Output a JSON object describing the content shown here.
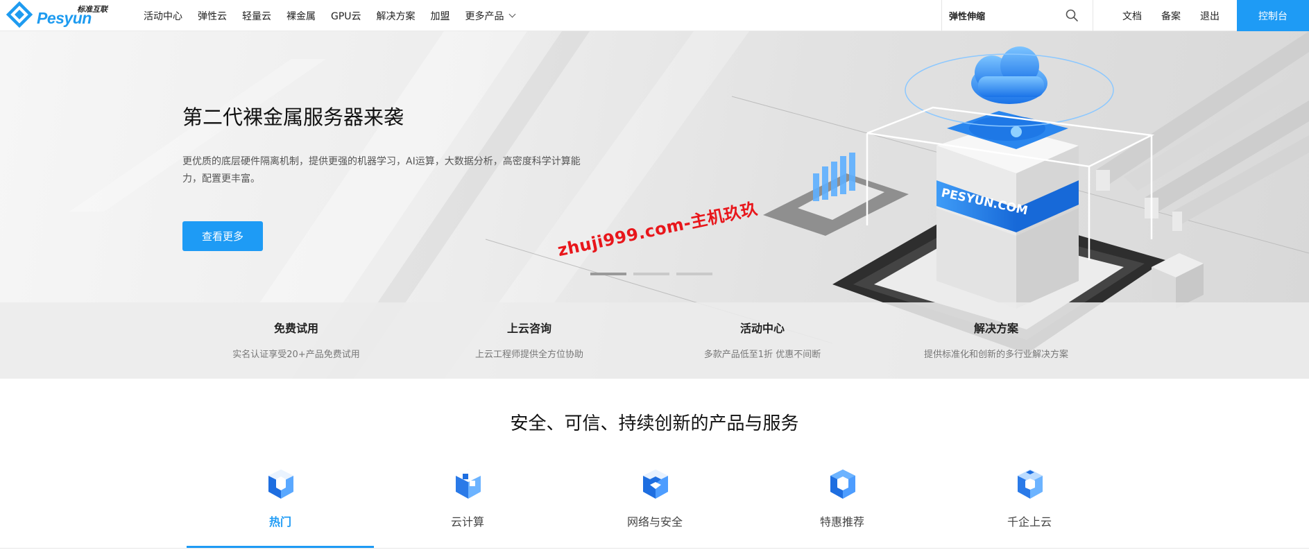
{
  "header": {
    "logo_text": "Pesyun",
    "logo_tagline": "标准互联",
    "nav": [
      {
        "label": "活动中心"
      },
      {
        "label": "弹性云"
      },
      {
        "label": "轻量云"
      },
      {
        "label": "裸金属"
      },
      {
        "label": "GPU云"
      },
      {
        "label": "解决方案"
      },
      {
        "label": "加盟"
      },
      {
        "label": "更多产品",
        "has_dropdown": true
      }
    ],
    "search": {
      "value": "弹性伸缩",
      "icon": "search-icon"
    },
    "links": [
      {
        "label": "文档"
      },
      {
        "label": "备案"
      },
      {
        "label": "退出"
      }
    ],
    "console_label": "控制台"
  },
  "banner": {
    "title": "第二代裸金属服务器来袭",
    "description": "更优质的底层硬件隔离机制，提供更强的机器学习，AI运算，大数据分析，高密度科学计算能力，配置更丰富。",
    "button_label": "查看更多",
    "server_label": "PESYUN.COM",
    "watermark": "zhuji999.com-主机玖玖",
    "slides": 3,
    "active_slide": 1
  },
  "quick_links": [
    {
      "title": "免费试用",
      "desc": "实名认证享受20+产品免费试用"
    },
    {
      "title": "上云咨询",
      "desc": "上云工程师提供全方位协助"
    },
    {
      "title": "活动中心",
      "desc": "多款产品低至1折 优惠不间断"
    },
    {
      "title": "解决方案",
      "desc": "提供标准化和创新的多行业解决方案"
    }
  ],
  "section": {
    "title": "安全、可信、持续创新的产品与服务",
    "categories": [
      {
        "label": "热门",
        "icon": "hot-cube-icon",
        "active": true
      },
      {
        "label": "云计算",
        "icon": "cloud-computing-cube-icon"
      },
      {
        "label": "网络与安全",
        "icon": "network-security-cube-icon"
      },
      {
        "label": "特惠推荐",
        "icon": "special-offer-cube-icon"
      },
      {
        "label": "千企上云",
        "icon": "enterprise-cloud-cube-icon"
      }
    ]
  },
  "colors": {
    "accent": "#1e9bf5",
    "watermark": "#e8161b",
    "text": "#222222",
    "muted": "#777777"
  }
}
